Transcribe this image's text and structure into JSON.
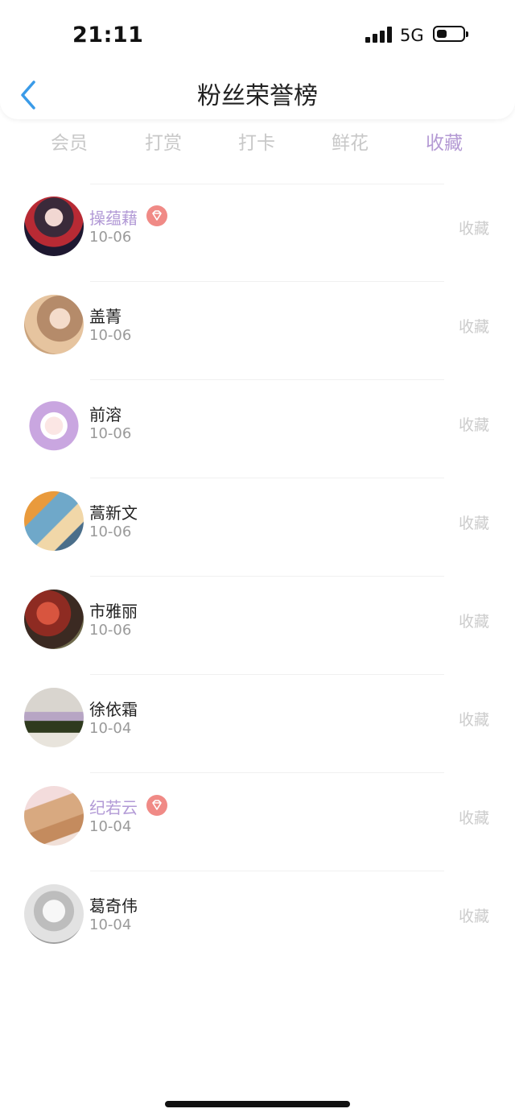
{
  "status_bar": {
    "time": "21:11",
    "network": "5G"
  },
  "nav": {
    "title": "粉丝荣誉榜",
    "back_icon": "chevron-left-icon"
  },
  "tabs": [
    {
      "label": "会员",
      "active": false
    },
    {
      "label": "打赏",
      "active": false
    },
    {
      "label": "打卡",
      "active": false
    },
    {
      "label": "鲜花",
      "active": false
    },
    {
      "label": "收藏",
      "active": true
    }
  ],
  "fans": [
    {
      "name": "操蕴藉",
      "date": "10-06",
      "action": "收藏",
      "vip": true
    },
    {
      "name": "盖菁",
      "date": "10-06",
      "action": "收藏",
      "vip": false
    },
    {
      "name": "前溶",
      "date": "10-06",
      "action": "收藏",
      "vip": false
    },
    {
      "name": "蒿新文",
      "date": "10-06",
      "action": "收藏",
      "vip": false
    },
    {
      "name": "市雅丽",
      "date": "10-06",
      "action": "收藏",
      "vip": false
    },
    {
      "name": "徐依霜",
      "date": "10-04",
      "action": "收藏",
      "vip": false
    },
    {
      "name": "纪若云",
      "date": "10-04",
      "action": "收藏",
      "vip": true
    },
    {
      "name": "葛奇伟",
      "date": "10-04",
      "action": "收藏",
      "vip": false
    }
  ],
  "colors": {
    "accent": "#b49ad4",
    "vip_name": "#b29ad6",
    "badge": "#f08a86",
    "back_icon": "#3a9be8",
    "inactive_tab": "#c8c8c8"
  }
}
